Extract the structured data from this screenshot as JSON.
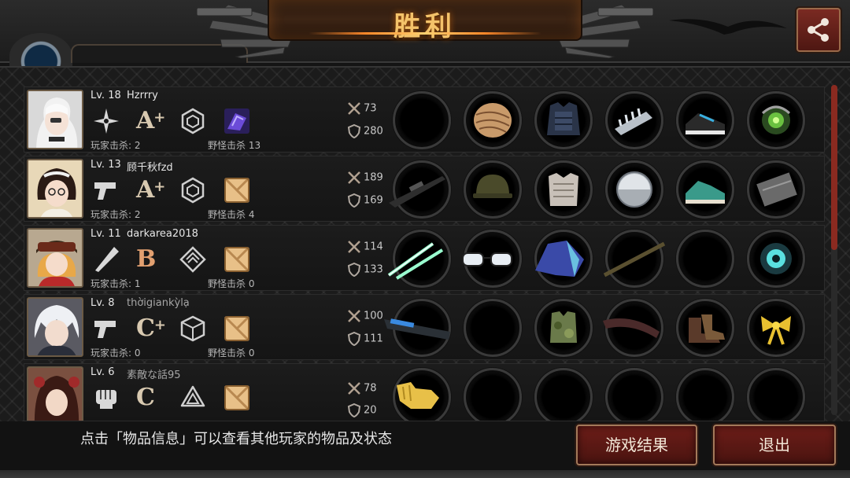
{
  "header": {
    "title": "胜利",
    "share_icon": "share-icon"
  },
  "players": [
    {
      "level": "Lv. 18",
      "name": "Hzrrry",
      "name_dim": false,
      "weapon_icon": "shuriken-icon",
      "grade": "A",
      "grade_plus": "+",
      "badge_icon": "hexagon-badge-icon",
      "skill_icon": "purple-skill-icon",
      "player_kills": "玩家击杀: 2",
      "monster_kills": "野怪击杀 13",
      "attack": "73",
      "defense": "280",
      "items": [
        "empty",
        "bandage-wrap",
        "body-armor",
        "spiked-bracer",
        "sneakers",
        "orb-gadget"
      ]
    },
    {
      "level": "Lv. 13",
      "name": "顾千秋fzd",
      "name_dim": false,
      "weapon_icon": "pistol-icon",
      "grade": "A",
      "grade_plus": "+",
      "badge_icon": "hexagon-badge-icon",
      "skill_icon": "box-skill-icon",
      "player_kills": "玩家击杀: 2",
      "monster_kills": "野怪击杀 4",
      "attack": "189",
      "defense": "169",
      "items": [
        "sniper-rifle",
        "military-helmet",
        "plate-armor",
        "metal-disc",
        "sneakers",
        "magazine"
      ]
    },
    {
      "level": "Lv. 11",
      "name": "darkarea2018",
      "name_dim": false,
      "weapon_icon": "bat-icon",
      "grade": "B",
      "grade_plus": "",
      "badge_icon": "diamond-badge-icon",
      "skill_icon": "box-skill-icon",
      "player_kills": "玩家击杀: 1",
      "monster_kills": "野怪击杀 0",
      "attack": "114",
      "defense": "133",
      "items": [
        "light-sabers",
        "glasses",
        "blue-cloak",
        "rod",
        "empty",
        "cyber-eye"
      ]
    },
    {
      "level": "Lv. 8",
      "name": "thờigiankỳlạ",
      "name_dim": true,
      "weapon_icon": "pistol-icon",
      "grade": "C",
      "grade_plus": "+",
      "badge_icon": "cube-badge-icon",
      "skill_icon": "box-skill-icon",
      "player_kills": "玩家击杀: 0",
      "monster_kills": "野怪击杀 0",
      "attack": "100",
      "defense": "111",
      "items": [
        "plasma-rifle",
        "empty",
        "camo-vest",
        "boomerang",
        "boots",
        "gold-ribbon"
      ]
    },
    {
      "level": "Lv. 6",
      "name": "素敵な話95",
      "name_dim": true,
      "weapon_icon": "fist-icon",
      "grade": "C",
      "grade_plus": "",
      "badge_icon": "triangle-badge-icon",
      "skill_icon": "box-skill-icon",
      "player_kills": "",
      "monster_kills": "",
      "attack": "78",
      "defense": "20",
      "items": [
        "gold-gauntlet",
        "empty",
        "empty",
        "empty",
        "empty",
        "empty"
      ]
    }
  ],
  "footer": {
    "hint": "点击「物品信息」可以查看其他玩家的物品及状态",
    "result_button": "游戏结果",
    "exit_button": "退出"
  }
}
